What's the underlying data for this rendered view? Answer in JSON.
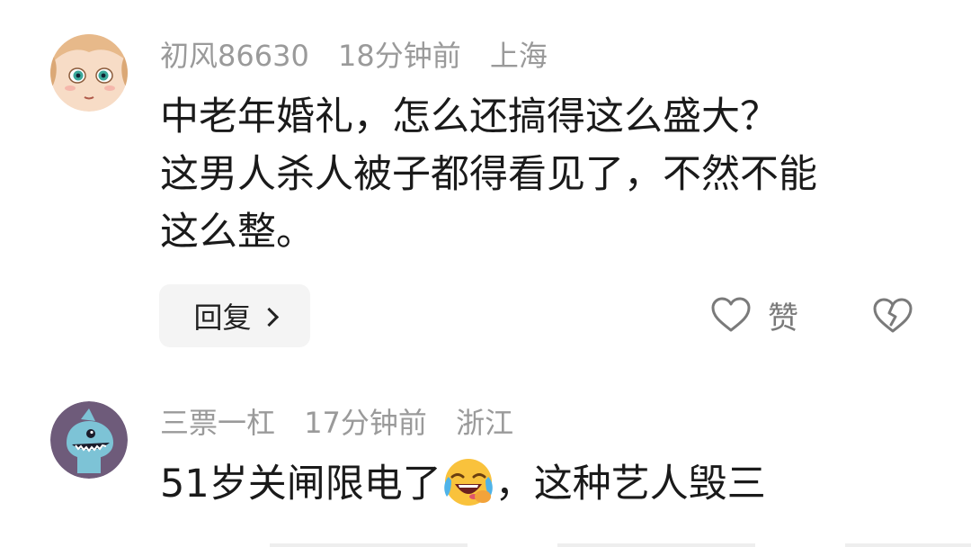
{
  "comments": [
    {
      "username": "初风86630",
      "time": "18分钟前",
      "location": "上海",
      "lines": [
        "中老年婚礼，怎么还搞得这么盛大？",
        "这男人杀人被子都得看见了，不然不能",
        "这么整。"
      ],
      "reply_label": "回复",
      "like_label": "赞"
    },
    {
      "username": "三票一杠",
      "time": "17分钟前",
      "location": "浙江",
      "text_before_emoji": "51岁关闸限电了",
      "emoji": "laughing-crying-emoji",
      "text_after_emoji": "，这种艺人毁三"
    }
  ],
  "colors": {
    "meta": "#9a9a9a",
    "text": "#1a1a1a",
    "reply_bg": "#f4f4f4",
    "icon": "#7a7a7a"
  }
}
